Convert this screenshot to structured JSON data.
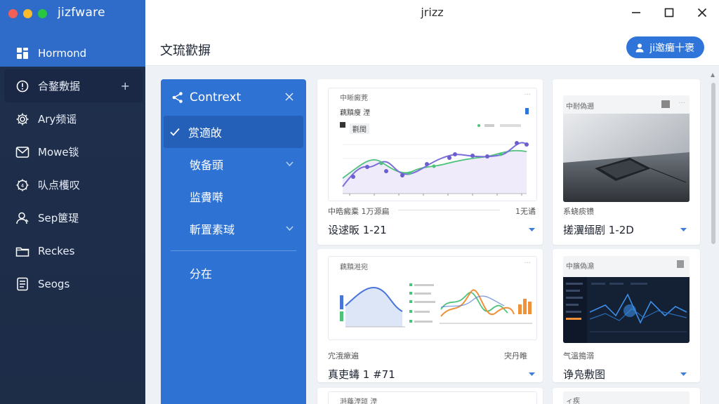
{
  "app": {
    "name": "jizfware",
    "window_title": "jrizz",
    "traffic_colors": [
      "#f25f57",
      "#f7bb2c",
      "#29c740"
    ]
  },
  "sidebar": {
    "items": [
      {
        "label": "Hormond",
        "icon": "grid-icon"
      },
      {
        "label": "合鍪敷据",
        "icon": "info-circle-icon",
        "action": "+"
      },
      {
        "label": "Ary频谣",
        "icon": "gear-icon"
      },
      {
        "label": "Mowe锬",
        "icon": "mail-icon"
      },
      {
        "label": "㕥点檴叹",
        "icon": "settings-badge-icon"
      },
      {
        "label": "Sep箧瑅",
        "icon": "user-icon"
      },
      {
        "label": "Reckes",
        "icon": "folder-icon"
      },
      {
        "label": "Seogs",
        "icon": "document-icon"
      }
    ]
  },
  "header": {
    "title": "文琉歡摒",
    "button_label": "ji邀癱十褒"
  },
  "context": {
    "title": "Contrext",
    "items": [
      {
        "label": "赏適敀",
        "selected": true
      },
      {
        "label": "敂备頭",
        "expandable": true
      },
      {
        "label": "监賮啭"
      },
      {
        "label": "斬置素琙",
        "expandable": true
      }
    ],
    "footer_item": "分在"
  },
  "cards": [
    {
      "thumb_title": "中晰癜茺",
      "thumb_subtitle": "藕黰痩 湮",
      "thumb_tag": "氍閠",
      "meta_left": "中晧癜槖 1万源扁",
      "meta_right": "1无谲",
      "title": "设逑昄 1-21"
    },
    {
      "thumb_title": "中耐偽遡",
      "meta_left": "系蛲痰镄",
      "title": "搓瀷缅剧 1-2D"
    },
    {
      "thumb_title": "藕黰溎宛",
      "meta_left": "宂涐瘶遍",
      "meta_right": "宊丹睢",
      "title": "真吏蝳 1 #71"
    },
    {
      "thumb_title": "中臏偽濎",
      "meta_left": "气溫搗溺",
      "title": "诤凫敷图"
    },
    {
      "thumb_title": "溡蘒湮颕 湮"
    },
    {
      "thumb_title": "ィ疾"
    }
  ],
  "colors": {
    "sidebar_top": "#2f6cc9",
    "sidebar_dark": "#1d2c47",
    "accent": "#2e73d3",
    "chart_purple": "#7a6fd8",
    "chart_green": "#4cc27a",
    "chart_orange": "#f0913a"
  }
}
